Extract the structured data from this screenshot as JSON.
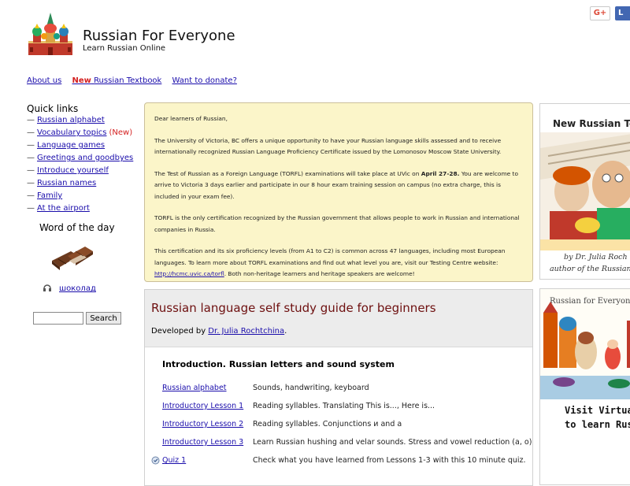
{
  "share": {
    "gplus_label": "G+",
    "fb_label": "L"
  },
  "header": {
    "title": "Russian For Everyone",
    "subtitle": "Learn Russian Online"
  },
  "topnav": {
    "about": "About us",
    "new_word": "New",
    "textbook": "Russian Textbook",
    "donate": "Want to donate?"
  },
  "sidebar": {
    "quick_links_title": "Quick links",
    "links": [
      {
        "label": "Russian alphabet"
      },
      {
        "label": "Vocabulary topics",
        "tag": "(New)"
      },
      {
        "label": "Language games"
      },
      {
        "label": "Greetings and goodbyes"
      },
      {
        "label": "Introduce yourself"
      },
      {
        "label": "Russian names"
      },
      {
        "label": "Family"
      },
      {
        "label": "At the airport"
      }
    ],
    "word_of_day_title": "Word of the day",
    "word_of_day": "шоколад",
    "search_button": "Search"
  },
  "notice": {
    "greeting": "Dear learners of Russian,",
    "p1": "The University of Victoria, BC offers a unique opportunity to have your Russian language skills assessed and to receive internationally recognized Russian Language Proficiency Certificate issued by the Lomonosov Moscow State University.",
    "p2_before": "The Test of Russian as a Foreign Language (TORFL) examinations will take place at UVic on ",
    "p2_date": "April 27-28.",
    "p2_after": " You are welcome to arrive to Victoria 3 days earlier and participate in our 8 hour exam training session on campus (no extra charge, this is included in your exam fee).",
    "p3": "TORFL is the only certification recognized by the Russian government that allows people to work in Russian and international companies in Russia.",
    "p4_before": "This certification and its six proficiency levels (from A1 to C2) is common across 47 languages, including most European languages. To learn more about TORFL examinations and find out what level you are, visit our Testing Centre website: ",
    "p4_link": "http://hcmc.uvic.ca/torfl",
    "p4_after": ". Both non-heritage learners and heritage speakers are welcome!"
  },
  "guide": {
    "title": "Russian language self study guide for beginners",
    "developed_by": "Developed by ",
    "author_link": "Dr. Julia Rochtchina",
    "period": ".",
    "intro_title": "Introduction. Russian letters and sound system",
    "lessons": [
      {
        "name": "Russian alphabet",
        "desc": "Sounds, handwriting, keyboard"
      },
      {
        "name": "Introductory Lesson 1",
        "desc": "Reading syllables. Translating This is..., Here is..."
      },
      {
        "name": "Introductory Lesson 2",
        "desc": "Reading syllables. Conjunctions и and а"
      },
      {
        "name": "Introductory Lesson 3",
        "desc": "Learn Russian hushing and velar sounds. Stress and vowel reduction (a, o)"
      },
      {
        "name": "Quiz 1",
        "desc": "Check what you have learned from Lessons 1-3 with this 10 minute quiz."
      }
    ]
  },
  "ads": {
    "ad1_title": "New Russian Te",
    "ad1_by": "by Dr. Julia Roch",
    "ad1_author": "author of the Russian F",
    "ad2_img_text": "Russian for Everyone",
    "ad2_line1": "Visit Virtual",
    "ad2_line2": "to learn Russ"
  }
}
